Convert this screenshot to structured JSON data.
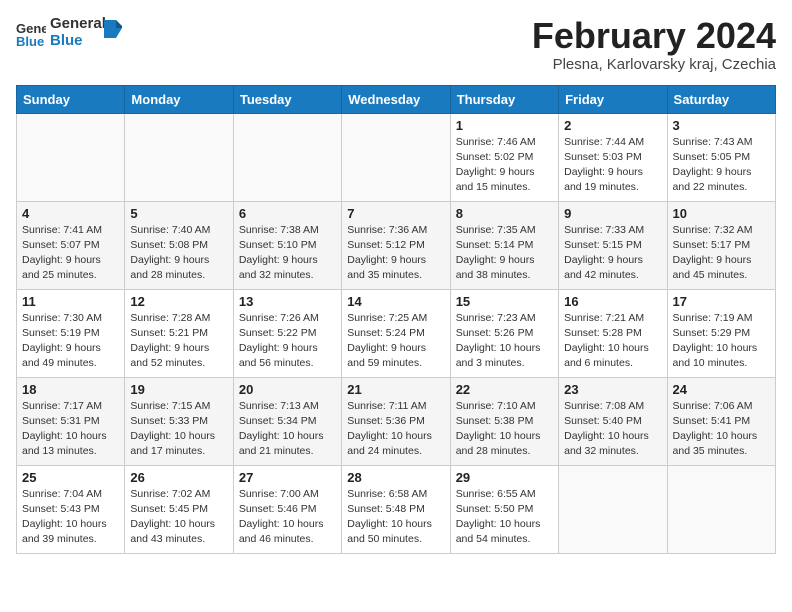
{
  "header": {
    "logo_general": "General",
    "logo_blue": "Blue",
    "title": "February 2024",
    "subtitle": "Plesna, Karlovarsky kraj, Czechia"
  },
  "weekdays": [
    "Sunday",
    "Monday",
    "Tuesday",
    "Wednesday",
    "Thursday",
    "Friday",
    "Saturday"
  ],
  "weeks": [
    [
      {
        "day": "",
        "info": ""
      },
      {
        "day": "",
        "info": ""
      },
      {
        "day": "",
        "info": ""
      },
      {
        "day": "",
        "info": ""
      },
      {
        "day": "1",
        "info": "Sunrise: 7:46 AM\nSunset: 5:02 PM\nDaylight: 9 hours\nand 15 minutes."
      },
      {
        "day": "2",
        "info": "Sunrise: 7:44 AM\nSunset: 5:03 PM\nDaylight: 9 hours\nand 19 minutes."
      },
      {
        "day": "3",
        "info": "Sunrise: 7:43 AM\nSunset: 5:05 PM\nDaylight: 9 hours\nand 22 minutes."
      }
    ],
    [
      {
        "day": "4",
        "info": "Sunrise: 7:41 AM\nSunset: 5:07 PM\nDaylight: 9 hours\nand 25 minutes."
      },
      {
        "day": "5",
        "info": "Sunrise: 7:40 AM\nSunset: 5:08 PM\nDaylight: 9 hours\nand 28 minutes."
      },
      {
        "day": "6",
        "info": "Sunrise: 7:38 AM\nSunset: 5:10 PM\nDaylight: 9 hours\nand 32 minutes."
      },
      {
        "day": "7",
        "info": "Sunrise: 7:36 AM\nSunset: 5:12 PM\nDaylight: 9 hours\nand 35 minutes."
      },
      {
        "day": "8",
        "info": "Sunrise: 7:35 AM\nSunset: 5:14 PM\nDaylight: 9 hours\nand 38 minutes."
      },
      {
        "day": "9",
        "info": "Sunrise: 7:33 AM\nSunset: 5:15 PM\nDaylight: 9 hours\nand 42 minutes."
      },
      {
        "day": "10",
        "info": "Sunrise: 7:32 AM\nSunset: 5:17 PM\nDaylight: 9 hours\nand 45 minutes."
      }
    ],
    [
      {
        "day": "11",
        "info": "Sunrise: 7:30 AM\nSunset: 5:19 PM\nDaylight: 9 hours\nand 49 minutes."
      },
      {
        "day": "12",
        "info": "Sunrise: 7:28 AM\nSunset: 5:21 PM\nDaylight: 9 hours\nand 52 minutes."
      },
      {
        "day": "13",
        "info": "Sunrise: 7:26 AM\nSunset: 5:22 PM\nDaylight: 9 hours\nand 56 minutes."
      },
      {
        "day": "14",
        "info": "Sunrise: 7:25 AM\nSunset: 5:24 PM\nDaylight: 9 hours\nand 59 minutes."
      },
      {
        "day": "15",
        "info": "Sunrise: 7:23 AM\nSunset: 5:26 PM\nDaylight: 10 hours\nand 3 minutes."
      },
      {
        "day": "16",
        "info": "Sunrise: 7:21 AM\nSunset: 5:28 PM\nDaylight: 10 hours\nand 6 minutes."
      },
      {
        "day": "17",
        "info": "Sunrise: 7:19 AM\nSunset: 5:29 PM\nDaylight: 10 hours\nand 10 minutes."
      }
    ],
    [
      {
        "day": "18",
        "info": "Sunrise: 7:17 AM\nSunset: 5:31 PM\nDaylight: 10 hours\nand 13 minutes."
      },
      {
        "day": "19",
        "info": "Sunrise: 7:15 AM\nSunset: 5:33 PM\nDaylight: 10 hours\nand 17 minutes."
      },
      {
        "day": "20",
        "info": "Sunrise: 7:13 AM\nSunset: 5:34 PM\nDaylight: 10 hours\nand 21 minutes."
      },
      {
        "day": "21",
        "info": "Sunrise: 7:11 AM\nSunset: 5:36 PM\nDaylight: 10 hours\nand 24 minutes."
      },
      {
        "day": "22",
        "info": "Sunrise: 7:10 AM\nSunset: 5:38 PM\nDaylight: 10 hours\nand 28 minutes."
      },
      {
        "day": "23",
        "info": "Sunrise: 7:08 AM\nSunset: 5:40 PM\nDaylight: 10 hours\nand 32 minutes."
      },
      {
        "day": "24",
        "info": "Sunrise: 7:06 AM\nSunset: 5:41 PM\nDaylight: 10 hours\nand 35 minutes."
      }
    ],
    [
      {
        "day": "25",
        "info": "Sunrise: 7:04 AM\nSunset: 5:43 PM\nDaylight: 10 hours\nand 39 minutes."
      },
      {
        "day": "26",
        "info": "Sunrise: 7:02 AM\nSunset: 5:45 PM\nDaylight: 10 hours\nand 43 minutes."
      },
      {
        "day": "27",
        "info": "Sunrise: 7:00 AM\nSunset: 5:46 PM\nDaylight: 10 hours\nand 46 minutes."
      },
      {
        "day": "28",
        "info": "Sunrise: 6:58 AM\nSunset: 5:48 PM\nDaylight: 10 hours\nand 50 minutes."
      },
      {
        "day": "29",
        "info": "Sunrise: 6:55 AM\nSunset: 5:50 PM\nDaylight: 10 hours\nand 54 minutes."
      },
      {
        "day": "",
        "info": ""
      },
      {
        "day": "",
        "info": ""
      }
    ]
  ]
}
